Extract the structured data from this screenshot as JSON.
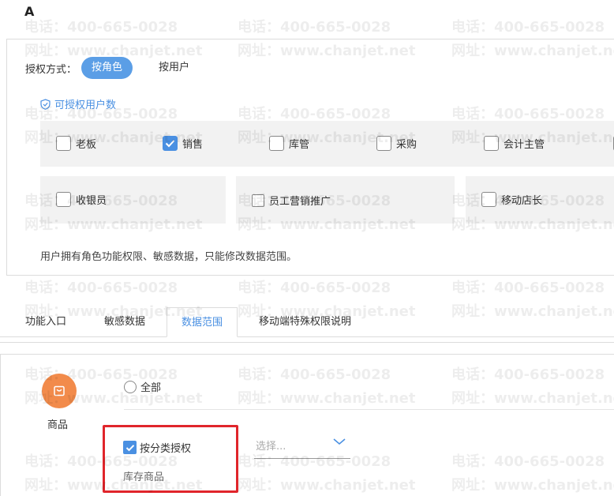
{
  "corner_label": "A",
  "auth": {
    "label": "授权方式：",
    "by_role": "按角色",
    "by_user": "按用户"
  },
  "licensable_label": "可授权用户数",
  "roles_row1": [
    {
      "label": "老板",
      "checked": false
    },
    {
      "label": "销售",
      "checked": true
    },
    {
      "label": "库管",
      "checked": false
    },
    {
      "label": "采购",
      "checked": false
    },
    {
      "label": "会计主管",
      "checked": false
    }
  ],
  "roles_row2": [
    {
      "label": "收银员",
      "checked": false
    },
    {
      "label": "员工营销推广",
      "checked": false
    },
    {
      "label": "移动店长",
      "checked": false
    }
  ],
  "role_note": "用户拥有角色功能权限、敏感数据，只能修改数据范围。",
  "tabs": [
    "功能入口",
    "敏感数据",
    "数据范围",
    "移动端特殊权限说明"
  ],
  "active_tab": "数据范围",
  "product": {
    "label": "商品",
    "all_option": "全部",
    "by_category": "按分类授权",
    "category_sub": "库存商品",
    "select_placeholder": "选择..."
  },
  "watermark": {
    "phone": "电话：400-665-0028",
    "site": "网址：www.chanjet.net"
  },
  "colors": {
    "accent": "#4a90e2",
    "segment_active": "#5b9ee6",
    "product_icon": "#f28b4b",
    "highlight": "#e0252b"
  }
}
